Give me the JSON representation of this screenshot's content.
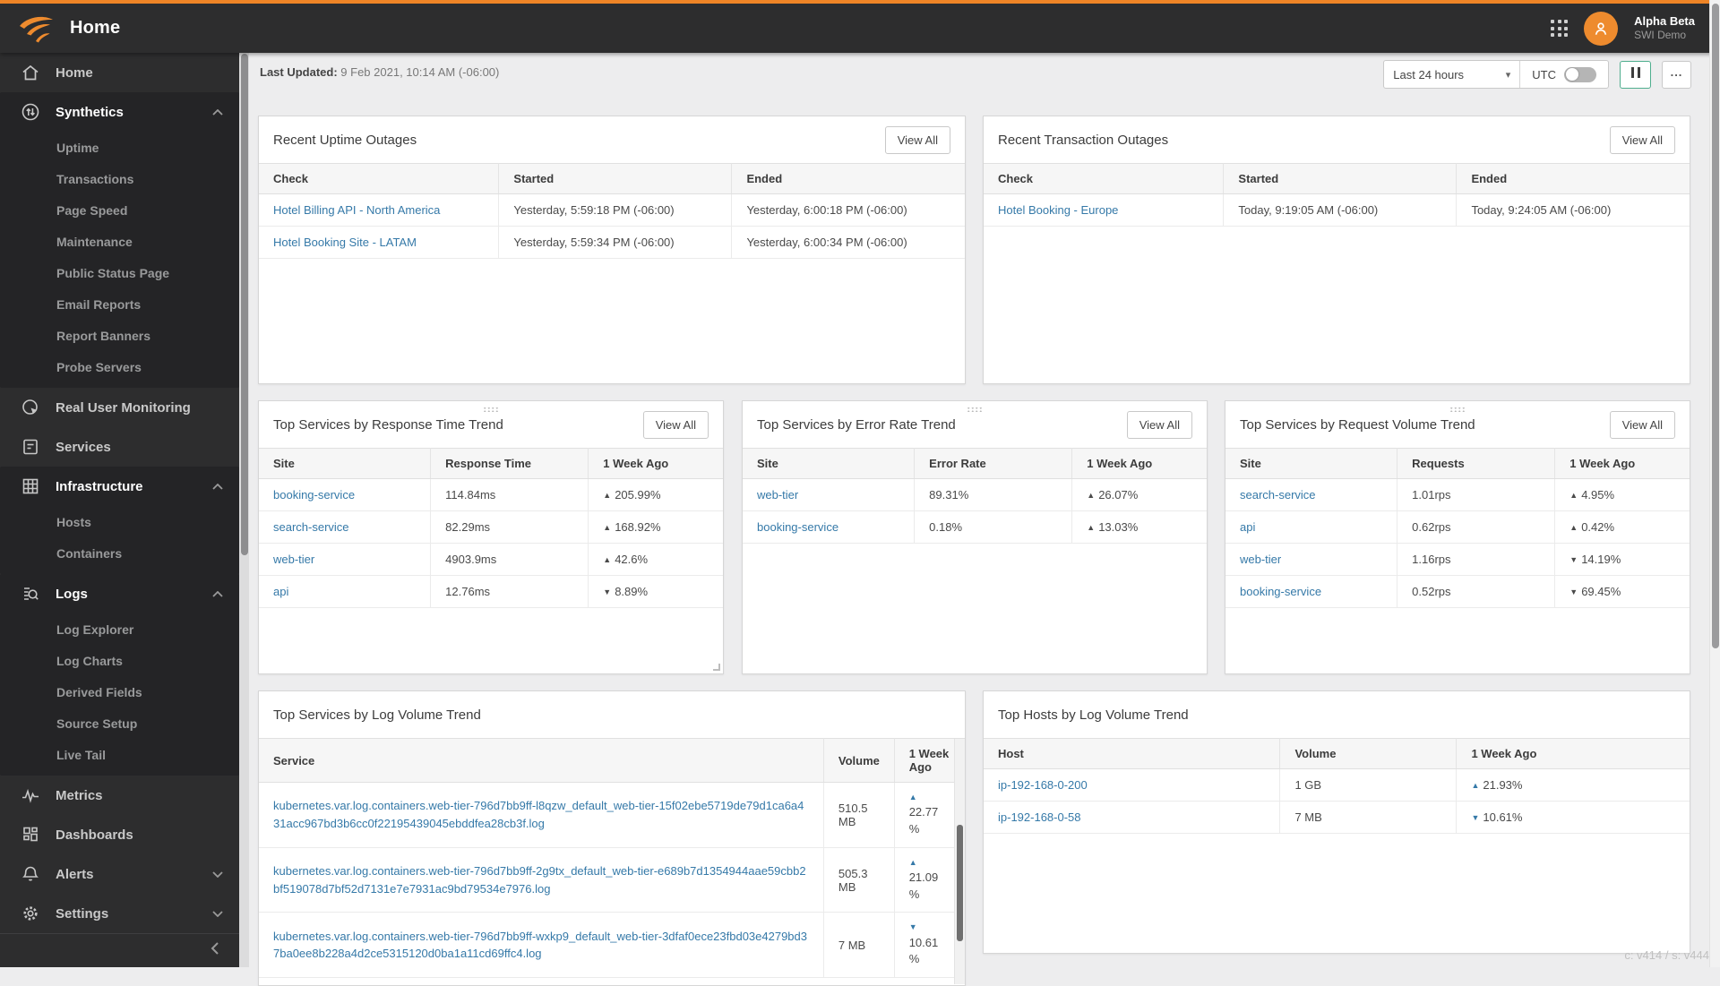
{
  "labels": {
    "view_all": "View All"
  },
  "header": {
    "title": "Home",
    "user": {
      "name": "Alpha Beta",
      "org": "SWI Demo"
    }
  },
  "sidebar": {
    "items": [
      {
        "label": "Home"
      },
      {
        "label": "Synthetics",
        "children": [
          "Uptime",
          "Transactions",
          "Page Speed",
          "Maintenance",
          "Public Status Page",
          "Email Reports",
          "Report Banners",
          "Probe Servers"
        ]
      },
      {
        "label": "Real User Monitoring"
      },
      {
        "label": "Services"
      },
      {
        "label": "Infrastructure",
        "children": [
          "Hosts",
          "Containers"
        ]
      },
      {
        "label": "Logs",
        "children": [
          "Log Explorer",
          "Log Charts",
          "Derived Fields",
          "Source Setup",
          "Live Tail"
        ]
      },
      {
        "label": "Metrics"
      },
      {
        "label": "Dashboards"
      },
      {
        "label": "Alerts"
      },
      {
        "label": "Settings"
      }
    ]
  },
  "toolbar": {
    "last_updated_label": "Last Updated:",
    "last_updated_value": "9 Feb 2021, 10:14 AM (-06:00)",
    "time_range_value": "Last 24 hours",
    "utc_label": "UTC"
  },
  "cards": {
    "uptime_outages": {
      "title": "Recent Uptime Outages",
      "columns": [
        "Check",
        "Started",
        "Ended"
      ],
      "rows": [
        {
          "check": "Hotel Billing API - North America",
          "started": "Yesterday, 5:59:18 PM (-06:00)",
          "ended": "Yesterday, 6:00:18 PM (-06:00)"
        },
        {
          "check": "Hotel Booking Site - LATAM",
          "started": "Yesterday, 5:59:34 PM (-06:00)",
          "ended": "Yesterday, 6:00:34 PM (-06:00)"
        }
      ]
    },
    "transaction_outages": {
      "title": "Recent Transaction Outages",
      "columns": [
        "Check",
        "Started",
        "Ended"
      ],
      "rows": [
        {
          "check": "Hotel Booking - Europe",
          "started": "Today, 9:19:05 AM (-06:00)",
          "ended": "Today, 9:24:05 AM (-06:00)"
        }
      ]
    },
    "response_time": {
      "title": "Top Services by Response Time Trend",
      "columns": [
        "Site",
        "Response Time",
        "1 Week Ago"
      ],
      "rows": [
        {
          "site": "booking-service",
          "value": "114.84ms",
          "trend": {
            "dir": "up",
            "pct": "205.99%",
            "color": "red"
          }
        },
        {
          "site": "search-service",
          "value": "82.29ms",
          "trend": {
            "dir": "up",
            "pct": "168.92%",
            "color": "red"
          }
        },
        {
          "site": "web-tier",
          "value": "4903.9ms",
          "trend": {
            "dir": "up",
            "pct": "42.6%",
            "color": "red"
          }
        },
        {
          "site": "api",
          "value": "12.76ms",
          "trend": {
            "dir": "down",
            "pct": "8.89%",
            "color": "green"
          }
        }
      ]
    },
    "error_rate": {
      "title": "Top Services by Error Rate Trend",
      "columns": [
        "Site",
        "Error Rate",
        "1 Week Ago"
      ],
      "rows": [
        {
          "site": "web-tier",
          "value": "89.31%",
          "trend": {
            "dir": "up",
            "pct": "26.07%",
            "color": "red"
          }
        },
        {
          "site": "booking-service",
          "value": "0.18%",
          "trend": {
            "dir": "up",
            "pct": "13.03%",
            "color": "red"
          }
        }
      ]
    },
    "request_volume": {
      "title": "Top Services by Request Volume Trend",
      "columns": [
        "Site",
        "Requests",
        "1 Week Ago"
      ],
      "rows": [
        {
          "site": "search-service",
          "value": "1.01rps",
          "trend": {
            "dir": "up",
            "pct": "4.95%",
            "color": "red"
          }
        },
        {
          "site": "api",
          "value": "0.62rps",
          "trend": {
            "dir": "up",
            "pct": "0.42%",
            "color": "red"
          }
        },
        {
          "site": "web-tier",
          "value": "1.16rps",
          "trend": {
            "dir": "down",
            "pct": "14.19%",
            "color": "green"
          }
        },
        {
          "site": "booking-service",
          "value": "0.52rps",
          "trend": {
            "dir": "down",
            "pct": "69.45%",
            "color": "green"
          }
        }
      ]
    },
    "log_services": {
      "title": "Top Services by Log Volume Trend",
      "columns": [
        "Service",
        "Volume",
        "1 Week Ago"
      ],
      "rows": [
        {
          "service": "kubernetes.var.log.containers.web-tier-796d7bb9ff-l8qzw_default_web-tier-15f02ebe5719de79d1ca6a431acc967bd3b6cc0f22195439045ebddfea28cb3f.log",
          "volume": "510.5 MB",
          "trend": {
            "dir": "up",
            "pct": "22.77 %",
            "color": "blue"
          }
        },
        {
          "service": "kubernetes.var.log.containers.web-tier-796d7bb9ff-2g9tx_default_web-tier-e689b7d1354944aae59cbb2bf519078d7bf52d7131e7e7931ac9bd79534e7976.log",
          "volume": "505.3 MB",
          "trend": {
            "dir": "up",
            "pct": "21.09 %",
            "color": "blue"
          }
        },
        {
          "service": "kubernetes.var.log.containers.web-tier-796d7bb9ff-wxkp9_default_web-tier-3dfaf0ece23fbd03e4279bd37ba0ee8b228a4d2ce5315120d0ba1a11cd69ffc4.log",
          "volume": "7 MB",
          "trend": {
            "dir": "down",
            "pct": "10.61 %",
            "color": "blue"
          }
        }
      ]
    },
    "log_hosts": {
      "title": "Top Hosts by Log Volume Trend",
      "columns": [
        "Host",
        "Volume",
        "1 Week Ago"
      ],
      "rows": [
        {
          "host": "ip-192-168-0-200",
          "volume": "1 GB",
          "trend": {
            "dir": "up",
            "pct": "21.93%",
            "color": "blue"
          }
        },
        {
          "host": "ip-192-168-0-58",
          "volume": "7 MB",
          "trend": {
            "dir": "down",
            "pct": "10.61%",
            "color": "blue"
          }
        }
      ]
    }
  },
  "footer": {
    "version": "c: v414 / s: v444"
  },
  "colors": {
    "accent_orange": "#EE8426",
    "link_blue": "#3579A8",
    "trend_red": "#E0604E",
    "trend_green": "#2F9E4F"
  }
}
